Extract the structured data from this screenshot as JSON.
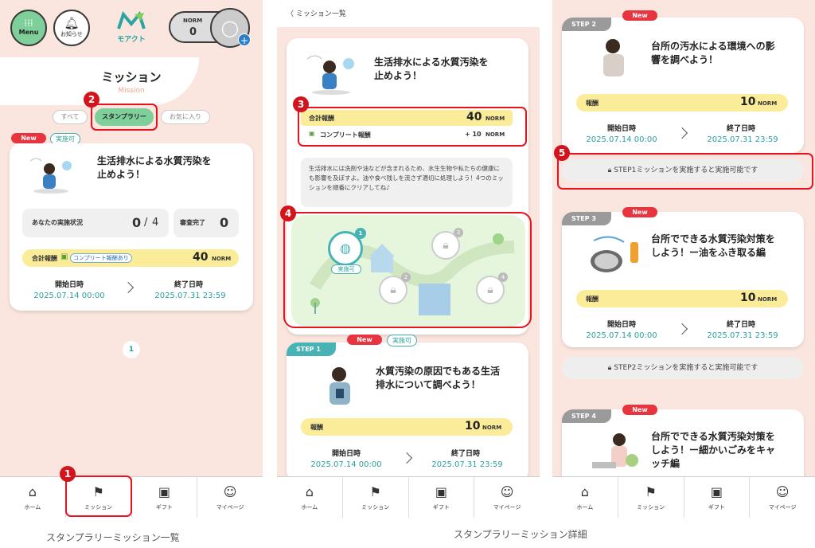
{
  "s1": {
    "menu": "Menu",
    "notice": "お知らせ",
    "logo": "モアクト",
    "norm_label": "NORM",
    "norm_value": "0",
    "title": "ミッション",
    "subtitle": "Mission",
    "tabs": [
      "すべて",
      "スタンプラリー",
      "お気に入り"
    ],
    "badge_new": "New",
    "badge_ok": "実施可",
    "mission_title": "生活排水による水質汚染を止めよう！",
    "status_label": "あなたの実施状況",
    "status_done": "0",
    "status_sep": "/",
    "status_total": "4",
    "review_label": "審査完了",
    "review_value": "0",
    "reward_label": "合計報酬",
    "complete_badge": "コンプリート報酬あり",
    "reward_value": "40",
    "norm": "NORM",
    "start_label": "開始日時",
    "start_date": "2025.07.14 00:00",
    "end_label": "終了日時",
    "end_date": "2025.07.31 23:59",
    "page": "1"
  },
  "s2": {
    "back": "ミッション一覧",
    "mission_title": "生活排水による水質汚染を止めよう！",
    "reward_label": "合計報酬",
    "reward_value": "40",
    "norm": "NORM",
    "complete_label": "コンプリート報酬",
    "complete_value": "+ 10",
    "description": "生活排水には洗剤や油などが含まれるため、水生生物や私たちの健康にも影響を及ぼすよ。油や食べ残しを流さず適切に処理しよう！4つのミッションを順番にクリアしてね♪",
    "map_ok": "実施可",
    "map_nums": [
      "1",
      "2",
      "3",
      "4"
    ],
    "step": "STEP 1",
    "badge_new": "New",
    "badge_ok": "実施可",
    "step1_title": "水質汚染の原因でもある生活排水について調べよう！",
    "reward_small": "報酬",
    "step1_value": "10",
    "start_label": "開始日時",
    "start_date": "2025.07.14 00:00",
    "end_label": "終了日時",
    "end_date": "2025.07.31 23:59"
  },
  "s3": {
    "step2": "STEP 2",
    "step3": "STEP 3",
    "step4": "STEP 4",
    "badge_new": "New",
    "step2_title": "台所の汚水による環境への影響を調べよう！",
    "step3_title": "台所でできる水質汚染対策をしよう！ー油をふき取る編",
    "step4_title": "台所でできる水質汚染対策をしよう！ー細かいごみをキャッチ編",
    "reward_small": "報酬",
    "value": "10",
    "norm": "NORM",
    "start_label": "開始日時",
    "start_date": "2025.07.14 00:00",
    "end_label": "終了日時",
    "end_date": "2025.07.31 23:59",
    "lock1": "STEP1ミッションを実施すると実施可能です",
    "lock2": "STEP2ミッションを実施すると実施可能です"
  },
  "nav": [
    "ホーム",
    "ミッション",
    "ギフト",
    "マイページ"
  ],
  "annotations": [
    "1",
    "2",
    "3",
    "4",
    "5"
  ],
  "captions": [
    "スタンプラリーミッション一覧",
    "スタンプラリーミッション詳細"
  ],
  "colors": {
    "accent": "#48b3b5",
    "new": "#e8343e",
    "reward": "#fbec9a",
    "date": "#2a9fa0",
    "peach": "#fbe5df",
    "map": "#e6f6dc",
    "annot": "#d3141c"
  }
}
